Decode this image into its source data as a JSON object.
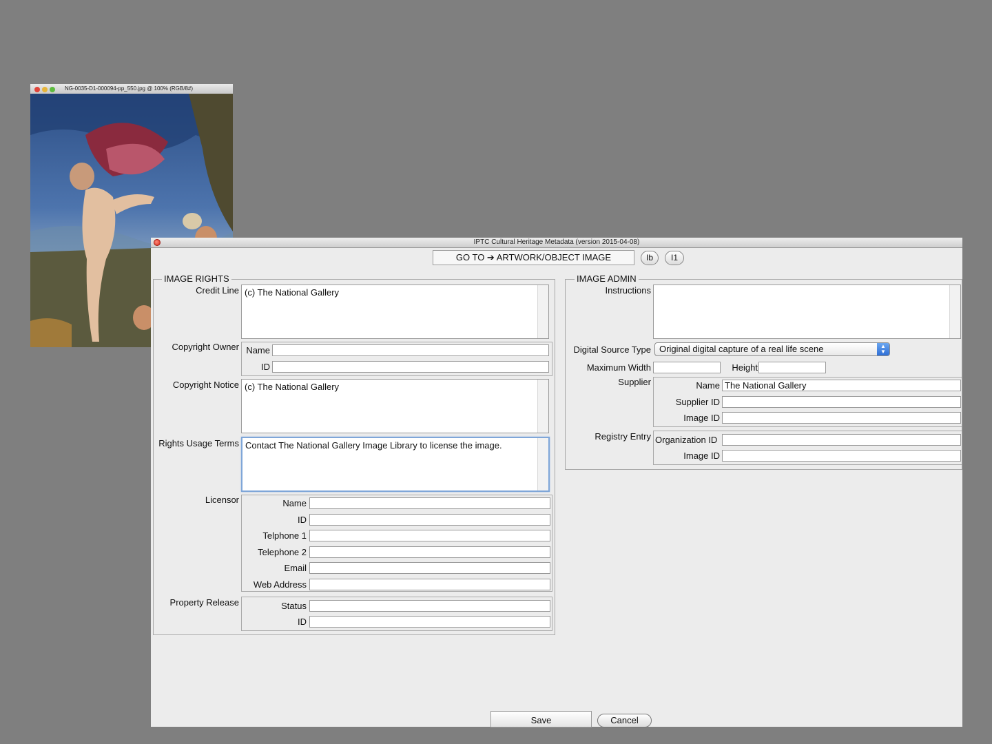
{
  "image_window": {
    "title": "NG-0035-D1-000094-pp_550.jpg @ 100% (RGB/8#)"
  },
  "dialog": {
    "title": "IPTC Cultural Heritage Metadata   (version 2015-04-08)",
    "goto_label": "GO TO ➔ ARTWORK/OBJECT    IMAGE",
    "nav_btn_1": "Ib",
    "nav_btn_2": "I1",
    "save_label": "Save",
    "cancel_label": "Cancel"
  },
  "rights": {
    "legend": "IMAGE RIGHTS",
    "credit_line_label": "Credit Line",
    "credit_line_value": "(c) The National Gallery",
    "copyright_owner_label": "Copyright Owner",
    "owner_name_label": "Name",
    "owner_name_value": "",
    "owner_id_label": "ID",
    "owner_id_value": "",
    "copyright_notice_label": "Copyright Notice",
    "copyright_notice_value": "(c) The National Gallery",
    "usage_terms_label": "Rights Usage Terms",
    "usage_terms_value": "Contact The National Gallery Image Library to license the image.",
    "licensor_label": "Licensor",
    "licensor_fields": [
      {
        "label": "Name",
        "value": ""
      },
      {
        "label": "ID",
        "value": ""
      },
      {
        "label": "Telphone 1",
        "value": ""
      },
      {
        "label": "Telephone 2",
        "value": ""
      },
      {
        "label": "Email",
        "value": ""
      },
      {
        "label": "Web Address",
        "value": ""
      }
    ],
    "property_release_label": "Property Release",
    "release_status_label": "Status",
    "release_status_value": "",
    "release_id_label": "ID",
    "release_id_value": ""
  },
  "admin": {
    "legend": "IMAGE ADMIN",
    "instructions_label": "Instructions",
    "instructions_value": "",
    "digital_source_label": "Digital Source Type",
    "digital_source_value": "Original digital capture of a real life scene",
    "max_width_label": "Maximum  Width",
    "max_width_value": "",
    "height_label": "Height",
    "height_value": "",
    "supplier_label": "Supplier",
    "supplier_name_label": "Name",
    "supplier_name_value": "The National Gallery",
    "supplier_id_label": "Supplier ID",
    "supplier_id_value": "",
    "supplier_image_id_label": "Image ID",
    "supplier_image_id_value": "",
    "registry_label": "Registry Entry",
    "registry_org_label": "Organization ID",
    "registry_org_value": "",
    "registry_image_id_label": "Image ID",
    "registry_image_id_value": ""
  }
}
